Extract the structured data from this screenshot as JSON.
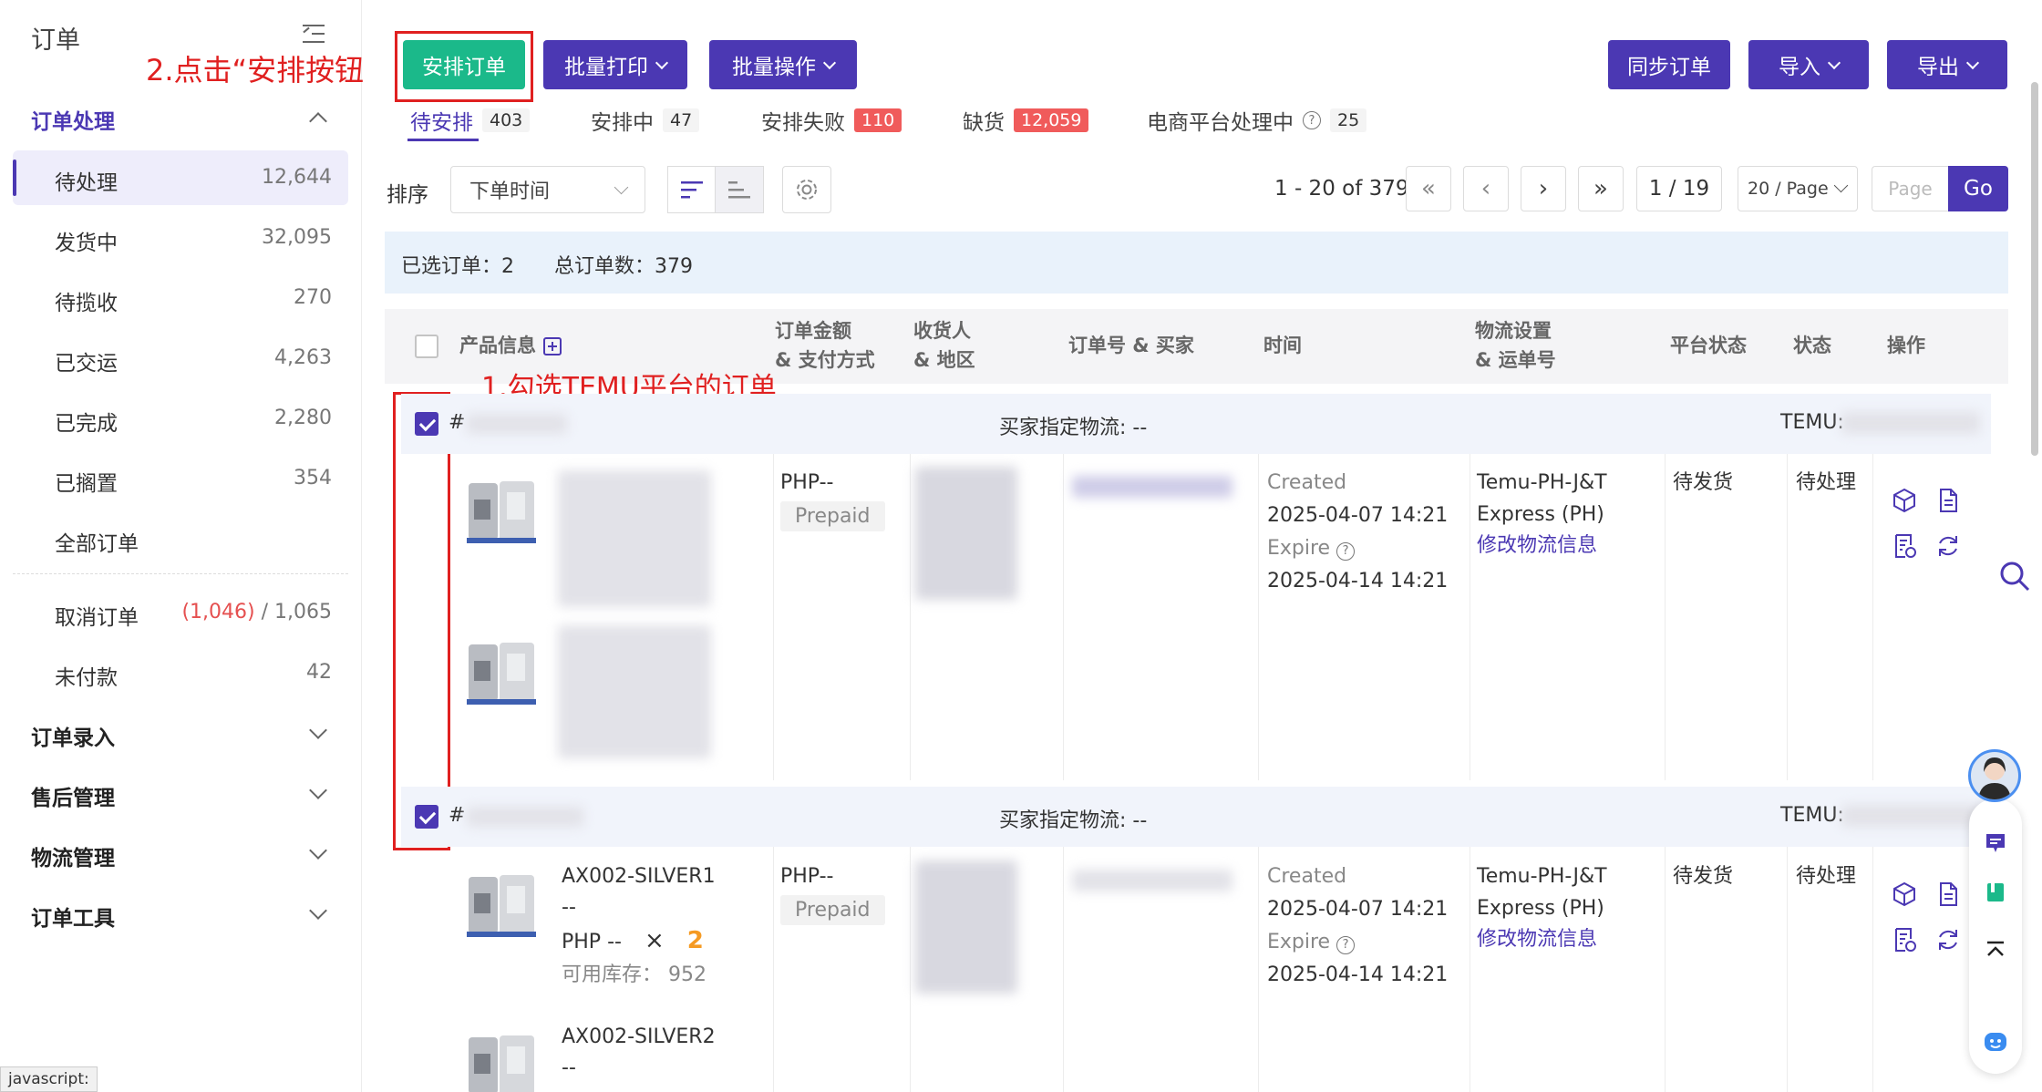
{
  "sidebar": {
    "title": "订单",
    "groups": [
      {
        "label": "订单处理"
      },
      {
        "label": "订单录入"
      },
      {
        "label": "售后管理"
      },
      {
        "label": "物流管理"
      },
      {
        "label": "订单工具"
      }
    ],
    "items": [
      {
        "label": "待处理",
        "count": "12,644"
      },
      {
        "label": "发货中",
        "count": "32,095"
      },
      {
        "label": "待揽收",
        "count": "270"
      },
      {
        "label": "已交运",
        "count": "4,263"
      },
      {
        "label": "已完成",
        "count": "2,280"
      },
      {
        "label": "已搁置",
        "count": "354"
      },
      {
        "label": "全部订单",
        "count": ""
      },
      {
        "label": "取消订单",
        "count_red": "(1,046)",
        "count": " / 1,065"
      },
      {
        "label": "未付款",
        "count": "42"
      }
    ]
  },
  "toolbar": {
    "arrange": "安排订单",
    "batch_print": "批量打印",
    "batch_ops": "批量操作",
    "sync": "同步订单",
    "import": "导入",
    "export": "导出"
  },
  "annotations": {
    "step2": "2.点击“安排按钮",
    "step1": "1.勾选TEMU平台的订单"
  },
  "tabs": [
    {
      "label": "待安排",
      "count": "403"
    },
    {
      "label": "安排中",
      "count": "47"
    },
    {
      "label": "安排失败",
      "count": "110"
    },
    {
      "label": "缺货",
      "count": "12,059"
    },
    {
      "label": "电商平台处理中",
      "count": "25"
    }
  ],
  "sort": {
    "label": "排序",
    "selected": "下单时间"
  },
  "pagination": {
    "range": "1 - 20 of 379",
    "page": "1 / 19",
    "per_page": "20 / Page",
    "page_placeholder": "Page",
    "go": "Go"
  },
  "info": {
    "selected": "已选订单：2",
    "total": "总订单数：379"
  },
  "table": {
    "headers": {
      "product": "产品信息",
      "amount_1": "订单金额",
      "amount_2": "& 支付方式",
      "receiver_1": "收货人",
      "receiver_2": "& 地区",
      "order_no": "订单号 & 买家",
      "time": "时间",
      "logistics_1": "物流设置",
      "logistics_2": "& 运单号",
      "platform_status": "平台状态",
      "status": "状态",
      "ops": "操作"
    }
  },
  "orders": [
    {
      "hash": "#",
      "logistics_hint": "买家指定物流: --",
      "platform": "TEMU:",
      "price": "PHP--",
      "payment": "Prepaid",
      "created_label": "Created",
      "created": "2025-04-07 14:21",
      "expire_label": "Expire",
      "expire": "2025-04-14 14:21",
      "carrier_1": "Temu-PH-J&T",
      "carrier_2": "Express (PH)",
      "edit_logistics": "修改物流信息",
      "platform_status": "待发货",
      "status": "待处理"
    },
    {
      "hash": "#",
      "logistics_hint": "买家指定物流: --",
      "platform": "TEMU:",
      "price": "PHP--",
      "payment": "Prepaid",
      "created_label": "Created",
      "created": "2025-04-07 14:21",
      "expire_label": "Expire",
      "expire": "2025-04-14 14:21",
      "carrier_1": "Temu-PH-J&T",
      "carrier_2": "Express (PH)",
      "edit_logistics": "修改物流信息",
      "platform_status": "待发货",
      "status": "待处理",
      "items": [
        {
          "sku": "AX002-SILVER1",
          "dash": "--",
          "price": "PHP --",
          "x": "×",
          "qty": "2",
          "stock_label": "可用库存：",
          "stock": "952"
        },
        {
          "sku": "AX002-SILVER2",
          "dash": "--"
        }
      ]
    }
  ],
  "status_bar": "javascript:",
  "colors": {
    "brand": "#4b38b3",
    "green": "#1bb98a",
    "annotation": "#e02020"
  }
}
